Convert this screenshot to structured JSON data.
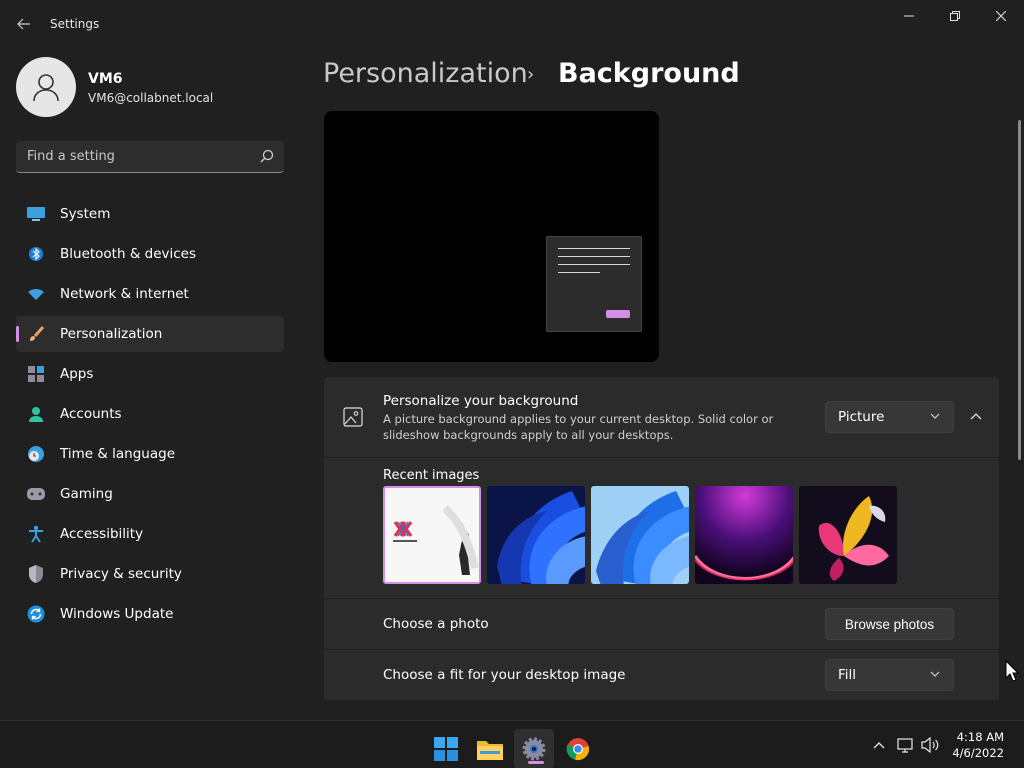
{
  "window": {
    "app_title": "Settings",
    "back_icon": "arrow-left-icon",
    "controls": [
      "minimize-icon",
      "restore-icon",
      "close-icon"
    ]
  },
  "user": {
    "name": "VM6",
    "email": "VM6@collabnet.local"
  },
  "search": {
    "placeholder": "Find a setting",
    "icon": "search-icon"
  },
  "nav": {
    "items": [
      {
        "label": "System",
        "icon": "monitor-icon",
        "selected": false
      },
      {
        "label": "Bluetooth & devices",
        "icon": "bluetooth-icon",
        "selected": false
      },
      {
        "label": "Network & internet",
        "icon": "wifi-icon",
        "selected": false
      },
      {
        "label": "Personalization",
        "icon": "brush-icon",
        "selected": true
      },
      {
        "label": "Apps",
        "icon": "apps-grid-icon",
        "selected": false
      },
      {
        "label": "Accounts",
        "icon": "person-icon",
        "selected": false
      },
      {
        "label": "Time & language",
        "icon": "clock-globe-icon",
        "selected": false
      },
      {
        "label": "Gaming",
        "icon": "gamepad-icon",
        "selected": false
      },
      {
        "label": "Accessibility",
        "icon": "accessibility-icon",
        "selected": false
      },
      {
        "label": "Privacy & security",
        "icon": "shield-icon",
        "selected": false
      },
      {
        "label": "Windows Update",
        "icon": "update-icon",
        "selected": false
      }
    ]
  },
  "header": {
    "parent": "Personalization",
    "separator": "›",
    "current": "Background"
  },
  "background_card": {
    "title": "Personalize your background",
    "description": "A picture background applies to your current desktop. Solid color or slideshow backgrounds apply to all your desktops.",
    "type_dropdown": "Picture",
    "recent_label": "Recent images",
    "recent_images": [
      {
        "name": "recent-image-darling-in-the-franxx",
        "selected": true
      },
      {
        "name": "recent-image-windows-bloom-dark",
        "selected": false
      },
      {
        "name": "recent-image-windows-bloom-light",
        "selected": false
      },
      {
        "name": "recent-image-purple-glow",
        "selected": false
      },
      {
        "name": "recent-image-flower-abstract",
        "selected": false
      }
    ],
    "choose_photo_label": "Choose a photo",
    "browse_button": "Browse photos",
    "fit_label": "Choose a fit for your desktop image",
    "fit_dropdown": "Fill"
  },
  "taskbar": {
    "apps": [
      "windows-start-icon",
      "file-explorer-icon",
      "settings-icon",
      "chrome-icon"
    ],
    "active_app": "settings-icon",
    "tray": [
      "chevron-up-icon",
      "network-icon",
      "volume-icon"
    ],
    "time": "4:18 AM",
    "date": "4/6/2022"
  },
  "colors": {
    "accent": "#d68ee9",
    "background": "#202020",
    "card": "#2b2b2b"
  }
}
